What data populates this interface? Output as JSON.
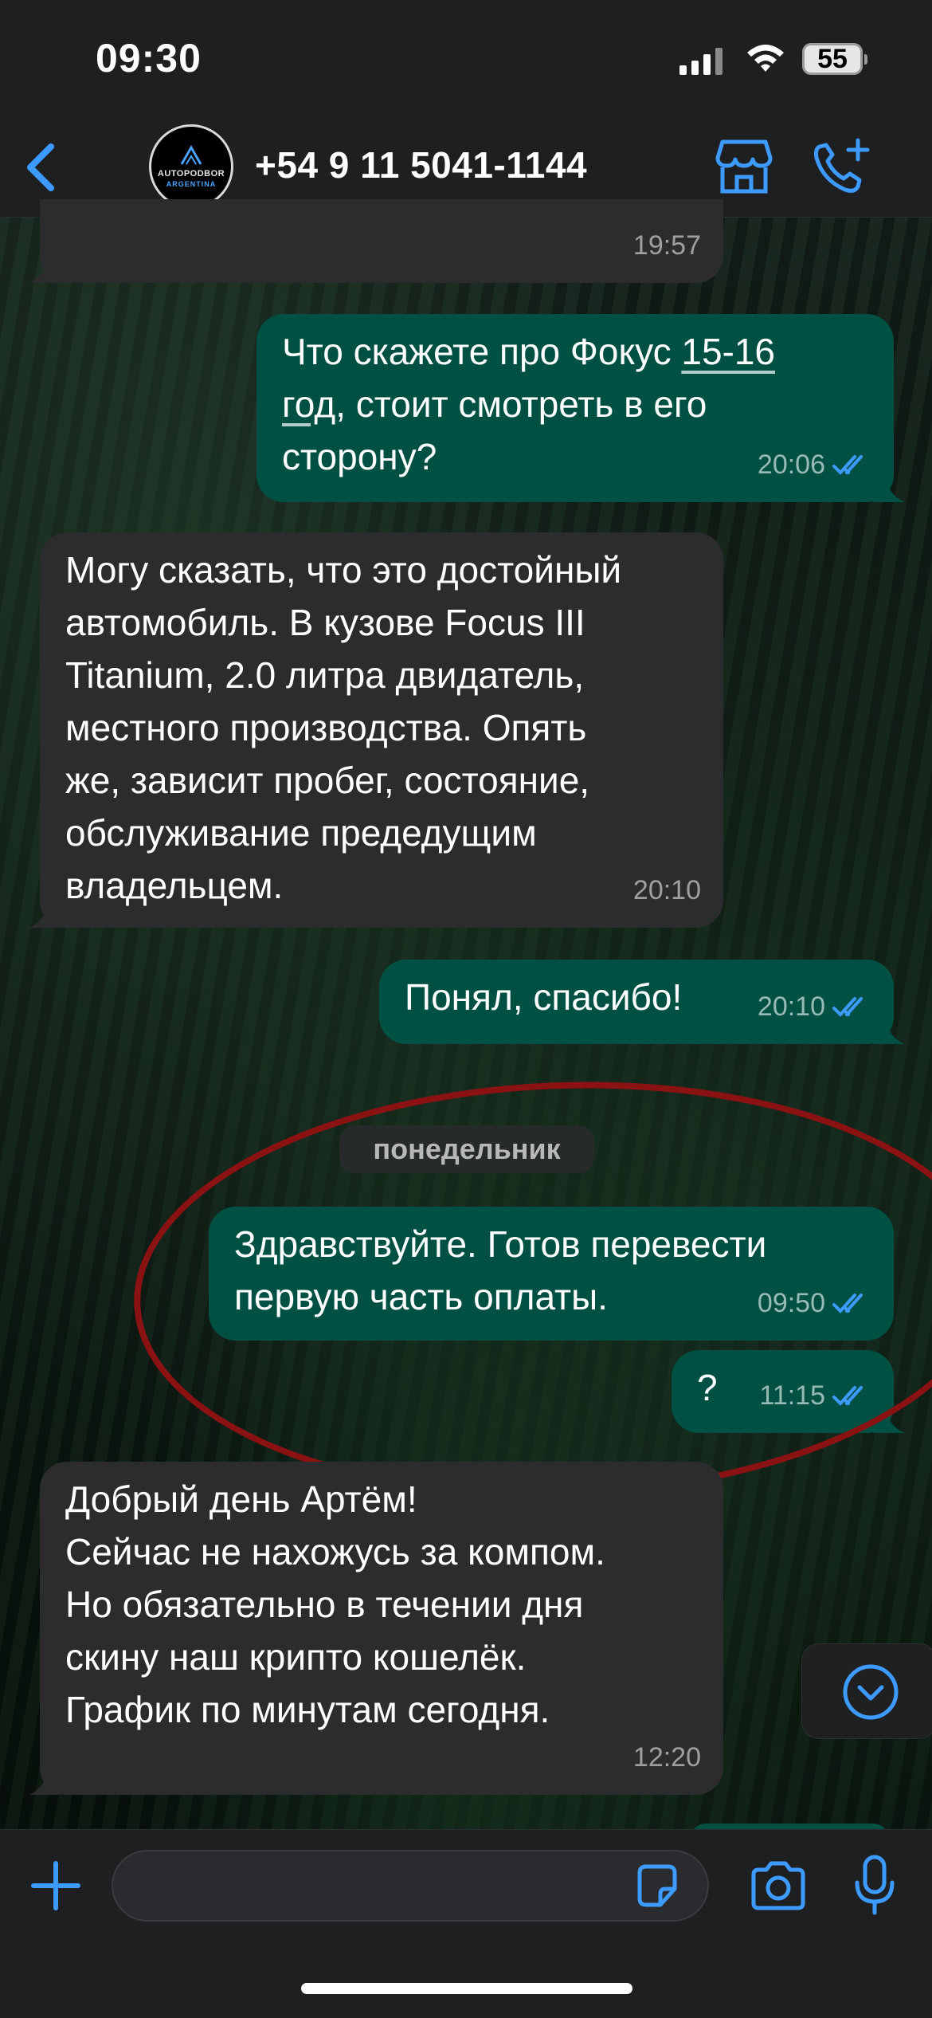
{
  "status_bar": {
    "time": "09:30",
    "battery": "55"
  },
  "header": {
    "contact_name": "+54 9 11 5041-1144",
    "avatar": {
      "line1": "AUTOPODBOR",
      "line2": "ARGENTINA"
    }
  },
  "messages": [
    {
      "direction": "in",
      "text": "",
      "time": "19:57"
    },
    {
      "direction": "out",
      "text_parts": [
        "Что скажете про Фокус ",
        "15-16",
        "\n",
        "год",
        ", стоит смотреть в его\nсторону?"
      ],
      "time": "20:06",
      "read": true
    },
    {
      "direction": "in",
      "text": "Могу сказать, что это достойный\nавтомобиль. В кузове Focus III\nTitanium, 2.0 литра двидатель,\nместного производства. Опять\nже, зависит пробег, состояние,\nобслуживание предедущим\nвладельцем.",
      "time": "20:10"
    },
    {
      "direction": "out",
      "text": "Понял, спасибо!",
      "time": "20:10",
      "read": true
    },
    {
      "direction": "out",
      "text": "Здравствуйте. Готов перевести\nпервую часть оплаты.",
      "time": "09:50",
      "read": true
    },
    {
      "direction": "out",
      "text": "?",
      "time": "11:15",
      "read": true
    },
    {
      "direction": "in",
      "text": "Добрый день Артём!\nСейчас не нахожусь за компом.\nНо обязательно в течении дня\nскину наш крипто кошелёк.\nГрафик по минутам сегодня.",
      "time": "12:20"
    }
  ],
  "day_separator": "понедельник",
  "composer": {
    "placeholder": "",
    "value": ""
  },
  "colors": {
    "outgoing_bubble": "#005144",
    "incoming_bubble": "#2c2c2e",
    "accent": "#3d9bff",
    "annotation_oval": "#8a1212"
  },
  "icons": {
    "back": "chevron-left-icon",
    "store": "storefront-icon",
    "call": "phone-plus-icon",
    "plus": "plus-icon",
    "sticker": "sticker-icon",
    "camera": "camera-icon",
    "mic": "microphone-icon",
    "scroll": "chevron-down-circle-icon",
    "read_receipt": "double-check-icon"
  }
}
